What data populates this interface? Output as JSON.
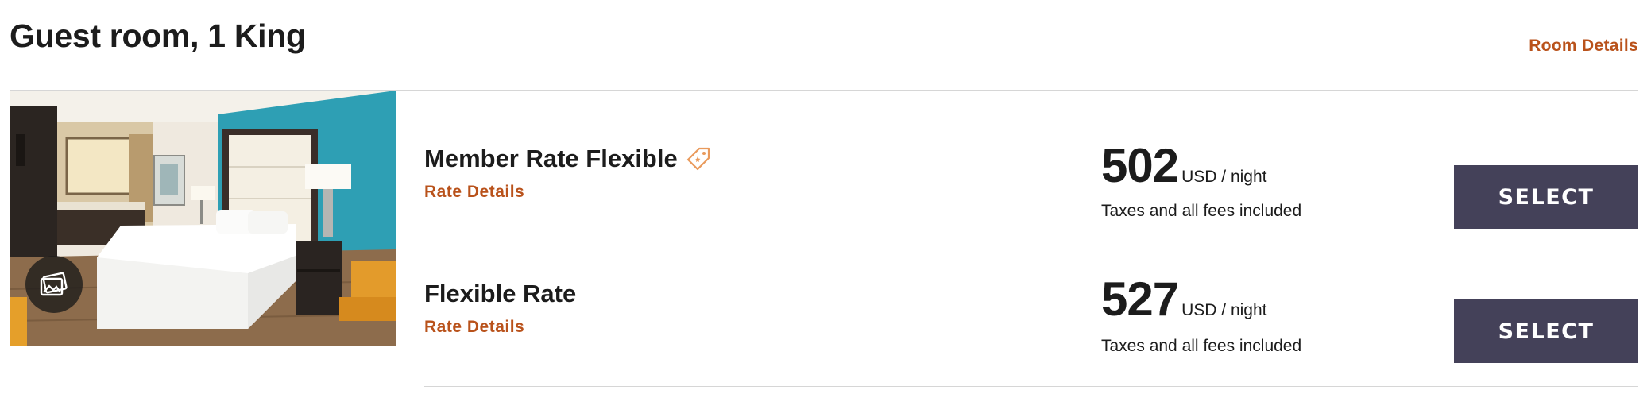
{
  "header": {
    "room_title": "Guest room, 1 King",
    "room_details_link": "Room Details"
  },
  "photo": {
    "gallery_icon": "gallery-icon",
    "colors": {
      "accent_wall": "#2e9fb4",
      "bed": "#ffffff",
      "chair": "#e39b2b",
      "floor": "#8d6c4c"
    }
  },
  "rates": [
    {
      "name": "Member Rate Flexible",
      "badge_icon": "member-tag-icon",
      "details_link": "Rate Details",
      "price": "502",
      "unit": "USD / night",
      "note": "Taxes and all fees included",
      "button": "SELECT"
    },
    {
      "name": "Flexible Rate",
      "details_link": "Rate Details",
      "price": "527",
      "unit": "USD / night",
      "note": "Taxes and all fees included",
      "button": "SELECT"
    }
  ],
  "colors": {
    "link": "#b9521b",
    "button_bg": "#444159",
    "button_text": "#ffffff",
    "divider": "#d6d6d6"
  }
}
